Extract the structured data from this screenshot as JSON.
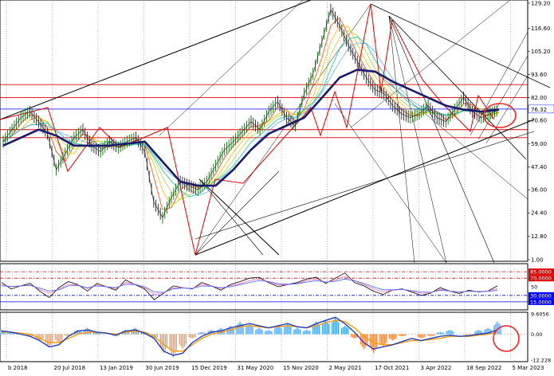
{
  "chart_data": {
    "type": "line",
    "title": "",
    "main_panel": {
      "y_ticks": [
        129.2,
        116.6,
        105.2,
        93.6,
        82.0,
        70.6,
        59.0,
        47.4,
        36.0,
        24.4,
        12.8,
        1.0
      ],
      "ylim": [
        1.0,
        130.0
      ],
      "current_price_label": "76.32",
      "price_series": {
        "name": "",
        "x": [
          0,
          5,
          10,
          15,
          20,
          25,
          30,
          35,
          40,
          45,
          50,
          55,
          60,
          65,
          70,
          75,
          80,
          85,
          90,
          95,
          100,
          105,
          110,
          115,
          120,
          125,
          130,
          135,
          140,
          145,
          150,
          155,
          160,
          165,
          170,
          175,
          180,
          185,
          190,
          195,
          200,
          205,
          210,
          215,
          220,
          225,
          230,
          235,
          240,
          245,
          250,
          255,
          260,
          265,
          270,
          275,
          280
        ],
        "values": [
          60,
          66,
          72,
          75,
          70,
          64,
          46,
          54,
          62,
          66,
          58,
          55,
          60,
          57,
          60,
          62,
          55,
          30,
          22,
          32,
          40,
          38,
          36,
          40,
          48,
          56,
          60,
          65,
          70,
          66,
          75,
          80,
          72,
          68,
          84,
          94,
          110,
          126,
          118,
          108,
          100,
          92,
          86,
          84,
          78,
          74,
          72,
          74,
          78,
          72,
          70,
          76,
          82,
          75,
          72,
          74,
          76
        ]
      },
      "moving_average": {
        "name": "",
        "color": "#1a1a6e",
        "x": [
          0,
          10,
          20,
          30,
          40,
          50,
          60,
          70,
          80,
          90,
          100,
          110,
          120,
          130,
          140,
          150,
          160,
          170,
          180,
          190,
          200,
          210,
          220,
          230,
          240,
          250,
          260,
          270,
          280
        ],
        "values": [
          58,
          62,
          66,
          63,
          58,
          58,
          58,
          59,
          60,
          50,
          40,
          38,
          38,
          46,
          56,
          64,
          68,
          72,
          82,
          92,
          96,
          95,
          90,
          86,
          82,
          78,
          76,
          75,
          76
        ]
      },
      "horizontal_levels": [
        {
          "value": 88.5,
          "color": "#e00000"
        },
        {
          "value": 82.0,
          "color": "#e00000"
        },
        {
          "value": 76.3,
          "color": "#4040ff"
        },
        {
          "value": 66.0,
          "color": "#e00000"
        },
        {
          "value": 62.0,
          "color": "#e00000"
        }
      ]
    },
    "oscillator_panel": {
      "y_ticks": [
        "85.0000",
        "70.0000",
        "50",
        "30.0000",
        "15.0000"
      ],
      "ylim": [
        0,
        100
      ],
      "levels": [
        {
          "value": 85,
          "label": "85.0000",
          "color": "#e00000",
          "style": "dashdot"
        },
        {
          "value": 70,
          "label": "70.0000",
          "color": "#e00000",
          "style": "dashdot"
        },
        {
          "value": 30,
          "label": "30.0000",
          "color": "#0000ff",
          "style": "dashdot"
        },
        {
          "value": 15,
          "label": "15.0000",
          "color": "#0000ff",
          "style": "solid"
        }
      ],
      "series": [
        {
          "name": "",
          "color": "#000000",
          "values": [
            60,
            45,
            52,
            58,
            40,
            25,
            48,
            62,
            55,
            40,
            58,
            50,
            42,
            66,
            55,
            45,
            20,
            35,
            52,
            48,
            45,
            60,
            52,
            42,
            55,
            62,
            70,
            72,
            60,
            50,
            55,
            60,
            68,
            72,
            58,
            70,
            82,
            60,
            52,
            40,
            32,
            42,
            45,
            38,
            30,
            35,
            48,
            40,
            34,
            42,
            38,
            40,
            52
          ]
        },
        {
          "name": "",
          "color": "#ff69b4",
          "values": [
            55,
            50,
            52,
            54,
            44,
            35,
            45,
            56,
            54,
            46,
            54,
            50,
            46,
            60,
            56,
            48,
            32,
            36,
            48,
            48,
            46,
            56,
            52,
            46,
            52,
            58,
            64,
            68,
            62,
            54,
            55,
            58,
            64,
            68,
            60,
            66,
            74,
            64,
            55,
            46,
            38,
            42,
            44,
            40,
            35,
            36,
            44,
            40,
            37,
            40,
            39,
            40,
            46
          ]
        },
        {
          "name": "",
          "color": "#4060ff",
          "values": [
            52,
            51,
            52,
            53,
            47,
            40,
            43,
            52,
            53,
            48,
            52,
            50,
            48,
            56,
            55,
            50,
            38,
            37,
            45,
            47,
            46,
            52,
            51,
            48,
            50,
            55,
            60,
            64,
            62,
            57,
            56,
            57,
            61,
            64,
            61,
            63,
            68,
            64,
            58,
            50,
            43,
            43,
            44,
            41,
            38,
            37,
            42,
            40,
            38,
            39,
            39,
            39,
            42
          ]
        }
      ]
    },
    "macd_panel": {
      "y_ticks": [
        "9.6056",
        "0.00",
        "-12.228"
      ],
      "ylim": [
        -12.228,
        9.6056
      ],
      "histogram": [
        2,
        1,
        0,
        -1,
        -3,
        -6,
        -4,
        -1,
        2,
        3,
        1,
        0,
        -1,
        2,
        3,
        1,
        -2,
        -9,
        -11,
        -7,
        -2,
        1,
        2,
        3,
        4,
        6,
        5,
        3,
        2,
        4,
        5,
        3,
        2,
        6,
        7,
        8,
        4,
        -2,
        -7,
        -9,
        -6,
        -3,
        -1,
        0,
        -2,
        -1,
        1,
        2,
        0,
        -1,
        2,
        3,
        6
      ],
      "signal": [
        1,
        1,
        0.5,
        0,
        -2,
        -4,
        -4,
        -2,
        0,
        1,
        1,
        0.5,
        0,
        1,
        1.5,
        1,
        -1,
        -5,
        -8,
        -8,
        -5,
        -2,
        0,
        1,
        2,
        3.5,
        4,
        3.5,
        3,
        3.5,
        4,
        3.5,
        3,
        4,
        5.5,
        6.5,
        6,
        3,
        -1,
        -4,
        -5,
        -5,
        -4,
        -3,
        -3,
        -2.5,
        -2,
        -1,
        -1,
        -1,
        -0.5,
        0,
        1
      ],
      "macd": [
        1.5,
        1,
        0,
        -1,
        -3,
        -6,
        -5,
        -1,
        1.5,
        2,
        1,
        0.5,
        -0.5,
        1.5,
        2,
        0.5,
        -2,
        -8,
        -10,
        -9,
        -4,
        -1,
        1,
        1.5,
        3,
        4,
        5,
        4,
        3,
        4,
        5,
        3.5,
        3,
        5,
        6.5,
        8,
        5,
        1,
        -4,
        -7,
        -6,
        -5,
        -3.5,
        -2,
        -3,
        -2,
        -1,
        -0.5,
        -1,
        -0.8,
        0,
        0.5,
        2
      ]
    },
    "x_tick_labels": [
      "b 2018",
      "20 Jul 2018",
      "13 Jan 2019",
      "30 Jun 2019",
      "15 Dec 2019",
      "31 May 2020",
      "15 Nov 2020",
      "2 May 2021",
      "17 Oct 2021",
      "3 Apr 2022",
      "18 Sep 2022",
      "5 Mar 2023"
    ],
    "highlight_circles": 2
  }
}
